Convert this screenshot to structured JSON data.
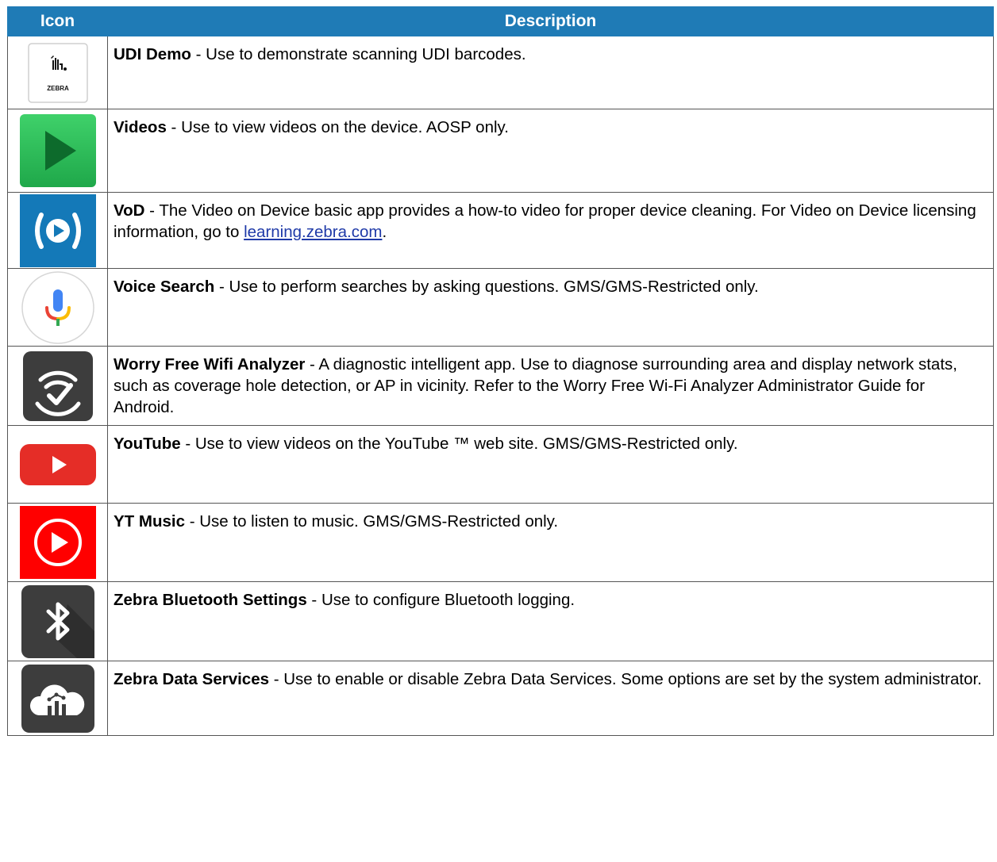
{
  "header": {
    "icon": "Icon",
    "description": "Description"
  },
  "rows": [
    {
      "icon": "zebra-udi-icon",
      "icon_text": "ZEBRA",
      "title": "UDI Demo",
      "desc": " - Use to demonstrate scanning UDI barcodes."
    },
    {
      "icon": "play-icon",
      "title": "Videos",
      "desc": " - Use to view videos on the device. AOSP only."
    },
    {
      "icon": "vod-icon",
      "title": "VoD",
      "desc": " - The Video on Device basic app provides a how-to video for proper device cleaning. For Video on Device licensing information, go to ",
      "link": "learning.zebra.com",
      "desc_after": "."
    },
    {
      "icon": "microphone-icon",
      "title": "Voice Search",
      "desc": " - Use to perform searches by asking questions. GMS/GMS-Restricted only."
    },
    {
      "icon": "wifi-check-icon",
      "title": "Worry Free Wifi Analyzer",
      "desc": " - A diagnostic intelligent app. Use to diagnose surrounding area and display network stats, such as coverage hole detection, or AP in vicinity. Refer to the Worry Free Wi-Fi Analyzer Administrator Guide for Android."
    },
    {
      "icon": "youtube-icon",
      "title": "YouTube",
      "desc": " - Use to view videos on the YouTube ™ web site. GMS/GMS-Restricted only."
    },
    {
      "icon": "yt-music-icon",
      "title": "YT Music",
      "desc": " - Use to listen to music. GMS/GMS-Restricted only."
    },
    {
      "icon": "bluetooth-icon",
      "title": "Zebra Bluetooth Settings",
      "desc": " - Use to configure Bluetooth logging."
    },
    {
      "icon": "cloud-chart-icon",
      "title": "Zebra Data Services",
      "desc": " - Use to enable or disable Zebra Data Services. Some options are set by the system administrator."
    }
  ],
  "colors": {
    "header_bg": "#1f7bb6",
    "link": "#1f3aa8"
  }
}
